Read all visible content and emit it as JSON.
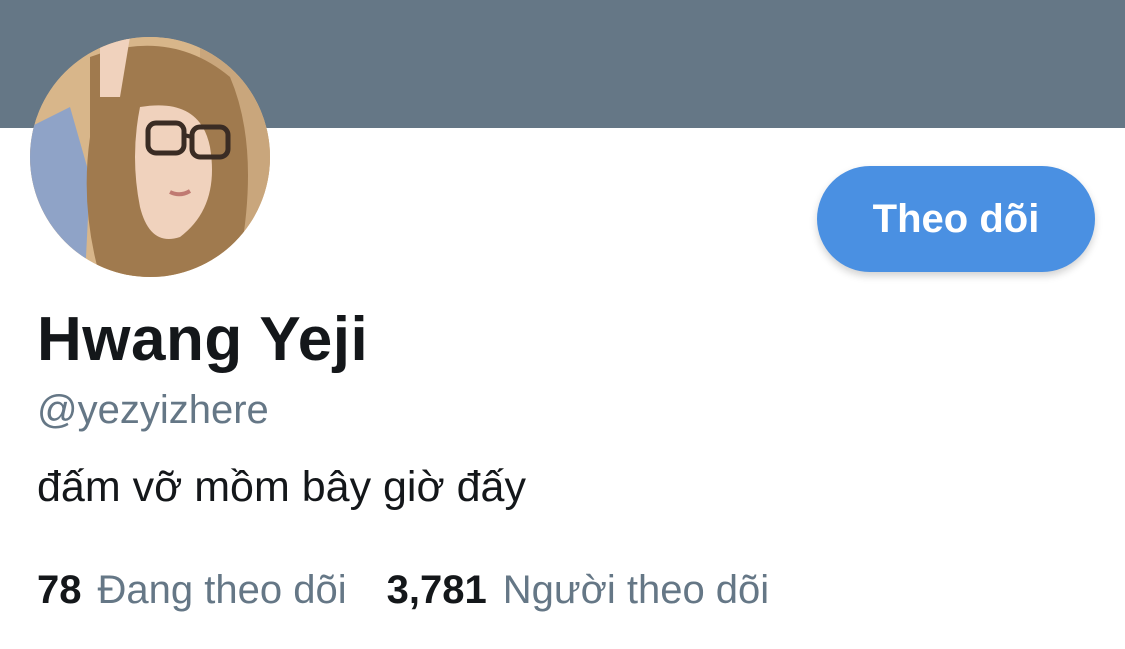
{
  "profile": {
    "display_name": "Hwang Yeji",
    "handle": "@yezyizhere",
    "bio": "đấm vỡ mồm bây giờ đấy",
    "follow_button_label": "Theo dõi"
  },
  "stats": {
    "following_count": "78",
    "following_label": "Đang theo dõi",
    "followers_count": "3,781",
    "followers_label": "Người theo dõi"
  },
  "colors": {
    "banner": "#657786",
    "accent": "#4a90e2",
    "primary_text": "#14171a",
    "secondary_text": "#657786"
  }
}
